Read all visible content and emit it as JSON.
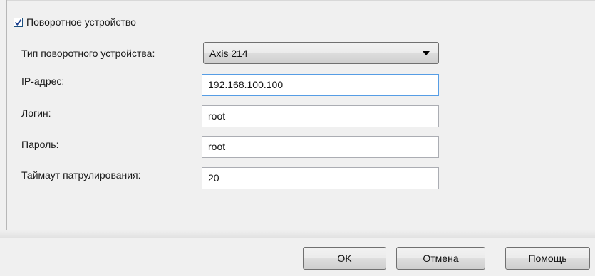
{
  "ptz": {
    "checkbox_label": "Поворотное устройство",
    "checked": true
  },
  "form": {
    "device_type": {
      "label": "Тип поворотного устройства:",
      "value": "Axis 214"
    },
    "ip": {
      "label": "IP-адрес:",
      "value": "192.168.100.100"
    },
    "login": {
      "label": "Логин:",
      "value": "root"
    },
    "password": {
      "label": "Пароль:",
      "value": "root"
    },
    "patrol_timeout": {
      "label": "Таймаут патрулирования:",
      "value": "20"
    }
  },
  "buttons": {
    "ok": "OK",
    "cancel": "Отмена",
    "help": "Помощь"
  }
}
